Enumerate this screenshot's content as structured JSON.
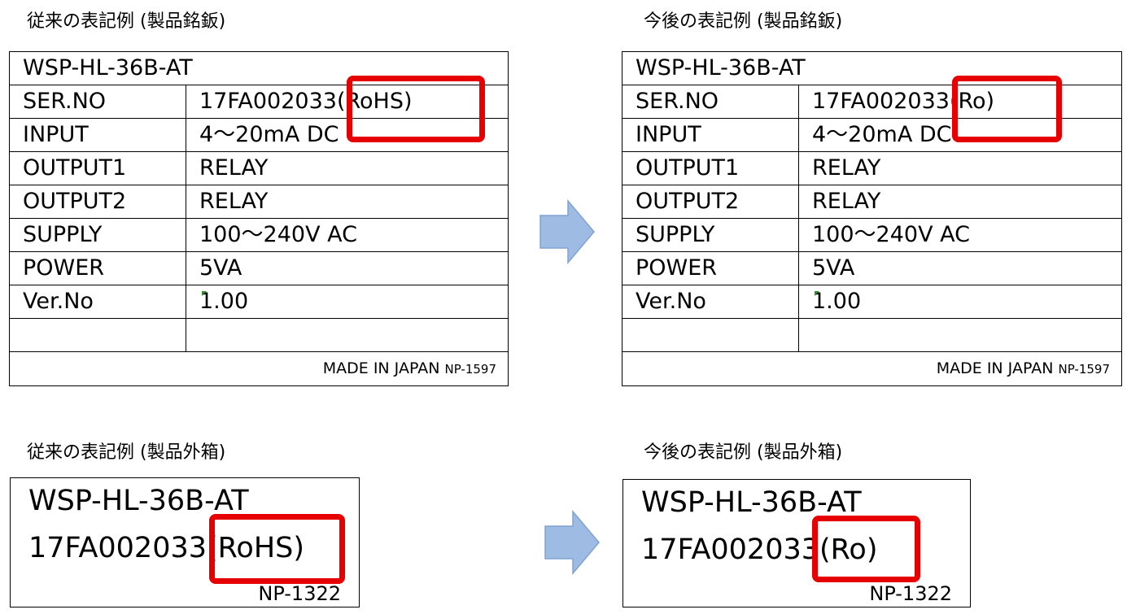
{
  "captions": {
    "old_plate": "従来の表記例 (製品銘鈑)",
    "new_plate": "今後の表記例 (製品銘鈑)",
    "old_box": "従来の表記例 (製品外箱)",
    "new_box": "今後の表記例 (製品外箱)"
  },
  "old_plate": {
    "model": "WSP-HL-36B-AT",
    "rows": [
      {
        "label": "SER.NO",
        "value": "17FA002033(RoHS)"
      },
      {
        "label": "INPUT",
        "value": "4～20mA DC"
      },
      {
        "label": "OUTPUT1",
        "value": "RELAY"
      },
      {
        "label": "OUTPUT2",
        "value": "RELAY"
      },
      {
        "label": "SUPPLY",
        "value": "100～240V AC"
      },
      {
        "label": "POWER",
        "value": "5VA"
      },
      {
        "label": "Ver.No",
        "value": "1.00"
      }
    ],
    "made_in": "MADE IN JAPAN",
    "code": "NP-1597"
  },
  "new_plate": {
    "model": "WSP-HL-36B-AT",
    "rows": [
      {
        "label": "SER.NO",
        "value": "17FA002033(Ro)"
      },
      {
        "label": "INPUT",
        "value": "4～20mA DC"
      },
      {
        "label": "OUTPUT1",
        "value": "RELAY"
      },
      {
        "label": "OUTPUT2",
        "value": "RELAY"
      },
      {
        "label": "SUPPLY",
        "value": "100～240V AC"
      },
      {
        "label": "POWER",
        "value": "5VA"
      },
      {
        "label": "Ver.No",
        "value": "1.00"
      }
    ],
    "made_in": "MADE IN JAPAN",
    "code": "NP-1597"
  },
  "old_box": {
    "model": "WSP-HL-36B-AT",
    "serial": "17FA002033(RoHS)",
    "code": "NP-1322"
  },
  "new_box": {
    "model": "WSP-HL-36B-AT",
    "serial": "17FA002033(Ro)",
    "code": "NP-1322"
  },
  "colors": {
    "highlight": "#e60000",
    "arrow_fill": "#9dbbe3",
    "arrow_stroke": "#7fa3d1"
  },
  "icons": {
    "arrow": "right-arrow-icon"
  }
}
